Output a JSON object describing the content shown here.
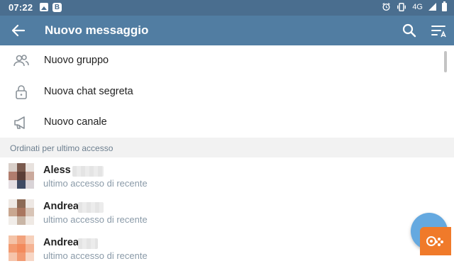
{
  "status_bar": {
    "time": "07:22",
    "network": "4G",
    "icons": [
      "image-icon",
      "b-app-icon",
      "alarm-icon",
      "vibrate-icon",
      "signal-icon",
      "battery-icon"
    ]
  },
  "app_bar": {
    "title": "Nuovo messaggio",
    "background": "#517da2",
    "icons": [
      "back-arrow-icon",
      "search-icon",
      "sort-icon"
    ]
  },
  "menu": [
    {
      "label": "Nuovo gruppo",
      "icon": "group-icon"
    },
    {
      "label": "Nuova chat segreta",
      "icon": "lock-icon"
    },
    {
      "label": "Nuovo canale",
      "icon": "megaphone-icon"
    }
  ],
  "section_header": "Ordinati per ultimo accesso",
  "contacts": [
    {
      "name": "Aless",
      "status": "ultimo accesso di recente"
    },
    {
      "name": "Andrea",
      "status": "ultimo accesso di recente"
    },
    {
      "name": "Andrea",
      "status": "ultimo accesso di recente"
    }
  ],
  "colors": {
    "accent": "#517da2",
    "status_bar": "#4a6e8f",
    "fab": "#65a9e0",
    "section_bg": "#f2f2f2",
    "secondary_text": "#8a9aa8"
  }
}
